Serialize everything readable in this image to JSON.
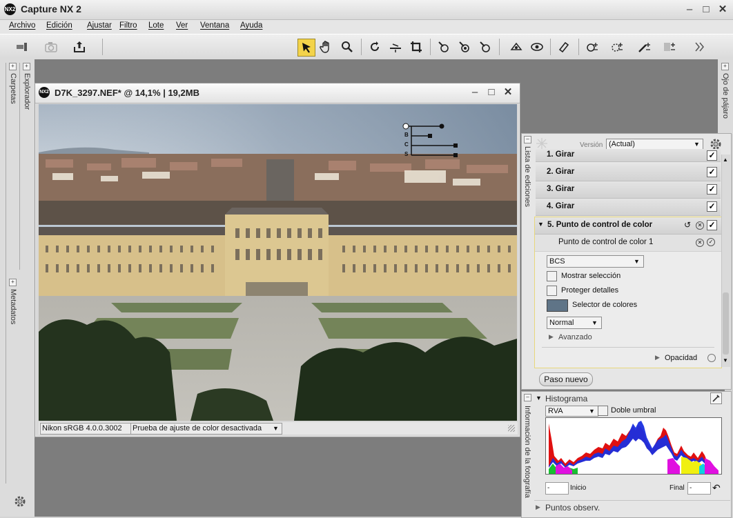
{
  "app": {
    "title": "Capture NX 2",
    "logo_text": "NX2"
  },
  "window_controls": {
    "minimize": "–",
    "maximize": "□",
    "close": "✕"
  },
  "menu": [
    "Archivo",
    "Edición",
    "Ajustar",
    "Filtro",
    "Lote",
    "Ver",
    "Ventana",
    "Ayuda"
  ],
  "toolbar_icons": [
    "browser-toggle-icon",
    "camera-icon",
    "upload-icon",
    "direct-select-arrow-icon",
    "hand-icon",
    "zoom-icon",
    "rotate-icon",
    "straighten-icon",
    "crop-icon",
    "color-point-icon",
    "black-point-icon",
    "white-point-icon",
    "red-eye-icon",
    "auto-retouch-brush-icon",
    "lasso-icon",
    "selection-brush-plus-icon",
    "ellipse-plus-icon",
    "lasso-plus-icon",
    "brush-plus-icon",
    "gradient-plus-icon",
    "more-icon"
  ],
  "left_dock": {
    "tabs": [
      "Carpetas",
      "Explorador",
      "Metadatos"
    ]
  },
  "right_dock": {
    "bird_eye": "Ojo de pájaro",
    "edit_list": "Lista de ediciones",
    "photo_info": "Información de la fotografía"
  },
  "image_window": {
    "title": "D7K_3297.NEF* @ 14,1% | 19,2MB",
    "color_profile": "Nikon sRGB 4.0.0.3002",
    "softproof": "Prueba de ajuste de color desactivada",
    "control_point_labels": [
      "B",
      "C",
      "S"
    ]
  },
  "edit_list": {
    "version_label": "Versión",
    "version_value": "(Actual)",
    "steps": [
      {
        "label": "1. Girar",
        "checked": true
      },
      {
        "label": "2. Girar",
        "checked": true
      },
      {
        "label": "3. Girar",
        "checked": true
      },
      {
        "label": "4. Girar",
        "checked": true
      }
    ],
    "active_step": {
      "label": "5. Punto de control de color",
      "checked": true
    },
    "sub_item": "Punto de control de color 1",
    "mode_value": "BCS",
    "show_selection": "Mostrar selección",
    "protect_details": "Proteger detalles",
    "color_selector": "Selector de colores",
    "selector_color": "#5f7487",
    "blend_mode": "Normal",
    "advanced": "Avanzado",
    "opacity": "Opacidad",
    "new_step": "Paso nuevo"
  },
  "histogram": {
    "title": "Histograma",
    "channel": "RVA",
    "double_threshold": "Doble umbral",
    "start_label": "Inicio",
    "end_label": "Final",
    "start_value": "-",
    "end_value": "-"
  },
  "observation_points": "Puntos observ.",
  "colors": {
    "accent_yellow": "#e8d77a",
    "histogram_blue": "#1a2fe0",
    "histogram_red": "#e01010",
    "histogram_green": "#18c030",
    "histogram_yellow": "#f0f010",
    "histogram_magenta": "#e010e0",
    "histogram_cyan": "#10d0e0"
  }
}
